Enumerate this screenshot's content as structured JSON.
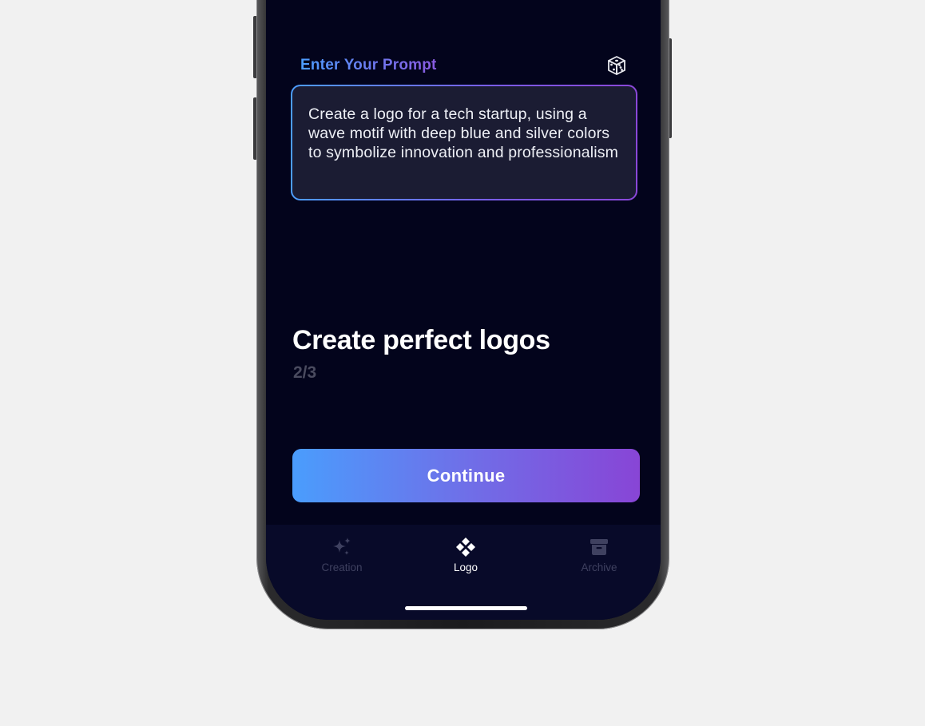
{
  "prompt_section": {
    "label": "Enter Your Prompt",
    "randomize_icon": "dice-icon",
    "prompt_text": "Create a logo for a tech startup, using a wave motif with deep blue and silver colors to symbolize innovation and professionalism"
  },
  "onboarding": {
    "headline": "Create perfect logos",
    "step": "2/3"
  },
  "continue_button": {
    "label": "Continue"
  },
  "tab_bar": {
    "tabs": [
      {
        "label": "Creation",
        "icon": "sparkles-icon",
        "active": false
      },
      {
        "label": "Logo",
        "icon": "logo-diamond-icon",
        "active": true
      },
      {
        "label": "Archive",
        "icon": "archive-box-icon",
        "active": false
      }
    ]
  },
  "colors": {
    "background": "#03041c",
    "accent_start": "#4a9dfd",
    "accent_end": "#8845d6",
    "inactive_tab": "#3f4160"
  }
}
